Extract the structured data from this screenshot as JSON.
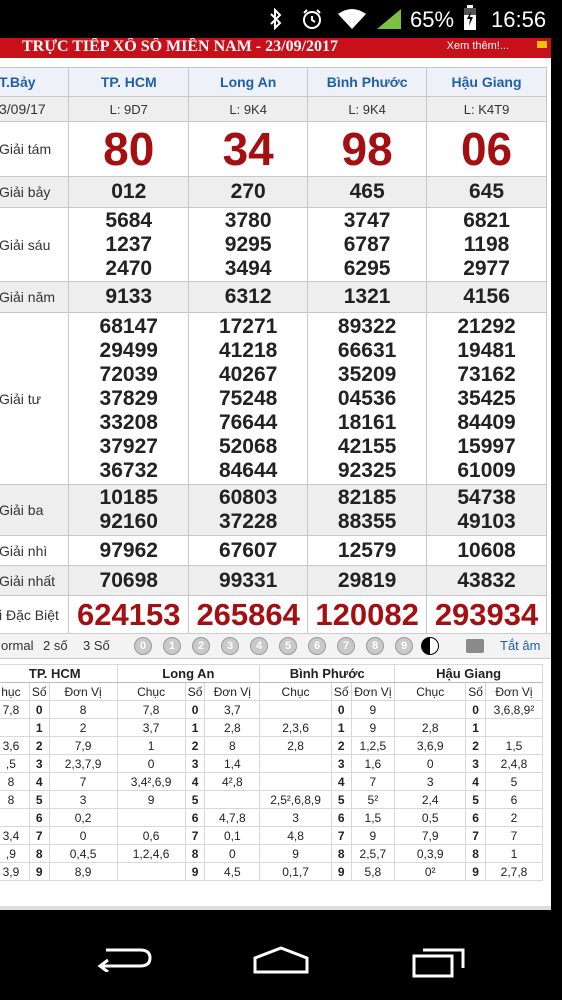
{
  "status_bar": {
    "battery": "65%",
    "time": "16:56"
  },
  "page": {
    "title": "TRỰC TIẾP XỔ SỐ MIỀN NAM - 23/09/2017",
    "more_link": "Xem thêm!..."
  },
  "results": {
    "day_label": "T.Bảy",
    "date": "3/09/17",
    "provinces": [
      "TP. HCM",
      "Long An",
      "Bình Phước",
      "Hậu Giang"
    ],
    "codes": [
      "L: 9D7",
      "L: 9K4",
      "L: 9K4",
      "L: K4T9"
    ],
    "prizes": [
      {
        "label": "Giải tám",
        "values": [
          [
            "80"
          ],
          [
            "34"
          ],
          [
            "98"
          ],
          [
            "06"
          ]
        ]
      },
      {
        "label": "Giải bảy",
        "values": [
          [
            "012"
          ],
          [
            "270"
          ],
          [
            "465"
          ],
          [
            "645"
          ]
        ]
      },
      {
        "label": "Giải sáu",
        "values": [
          [
            "5684",
            "1237",
            "2470"
          ],
          [
            "3780",
            "9295",
            "3494"
          ],
          [
            "3747",
            "6787",
            "6295"
          ],
          [
            "6821",
            "1198",
            "2977"
          ]
        ]
      },
      {
        "label": "Giải năm",
        "values": [
          [
            "9133"
          ],
          [
            "6312"
          ],
          [
            "1321"
          ],
          [
            "4156"
          ]
        ]
      },
      {
        "label": "Giải tư",
        "values": [
          [
            "68147",
            "29499",
            "72039",
            "37829",
            "33208",
            "37927",
            "36732"
          ],
          [
            "17271",
            "41218",
            "40267",
            "75248",
            "76644",
            "52068",
            "84644"
          ],
          [
            "89322",
            "66631",
            "35209",
            "04536",
            "18161",
            "42155",
            "92325"
          ],
          [
            "21292",
            "19481",
            "73162",
            "35425",
            "84409",
            "15997",
            "61009"
          ]
        ]
      },
      {
        "label": "Giải ba",
        "values": [
          [
            "10185",
            "92160"
          ],
          [
            "60803",
            "37228"
          ],
          [
            "82185",
            "88355"
          ],
          [
            "54738",
            "49103"
          ]
        ]
      },
      {
        "label": "Giải nhì",
        "values": [
          [
            "97962"
          ],
          [
            "67607"
          ],
          [
            "12579"
          ],
          [
            "10608"
          ]
        ]
      },
      {
        "label": "Giải nhất",
        "values": [
          [
            "70698"
          ],
          [
            "99331"
          ],
          [
            "29819"
          ],
          [
            "43832"
          ]
        ]
      },
      {
        "label": "i Đặc Biệt",
        "values": [
          [
            "624153"
          ],
          [
            "265864"
          ],
          [
            "120082"
          ],
          [
            "293934"
          ]
        ]
      }
    ]
  },
  "toolbar": {
    "mode_normal": "ormal",
    "mode_2": "2 số",
    "mode_3": "3 Số",
    "digits": [
      "0",
      "1",
      "2",
      "3",
      "4",
      "5",
      "6",
      "7",
      "8",
      "9"
    ],
    "mute_label": "Tắt âm"
  },
  "stats": {
    "col_chuc": "Chục",
    "col_so": "Số",
    "col_donvi": "Đơn Vị",
    "col_chuc_clipped": "hục",
    "provinces": [
      "TP. HCM",
      "Long An",
      "Bình Phước",
      "Hậu Giang"
    ],
    "rows": [
      [
        [
          "7,8",
          "0",
          "8"
        ],
        [
          "7,8",
          "0",
          "3,7"
        ],
        [
          "",
          "0",
          "9"
        ],
        [
          "",
          "0",
          "3,6,8,9²"
        ]
      ],
      [
        [
          "",
          "1",
          "2"
        ],
        [
          "3,7",
          "1",
          "2,8"
        ],
        [
          "2,3,6",
          "1",
          "9"
        ],
        [
          "2,8",
          "1",
          ""
        ]
      ],
      [
        [
          "3,6",
          "2",
          "7,9"
        ],
        [
          "1",
          "2",
          "8"
        ],
        [
          "2,8",
          "2",
          "1,2,5"
        ],
        [
          "3,6,9",
          "2",
          "1,5"
        ]
      ],
      [
        [
          ",5",
          "3",
          "2,3,7,9"
        ],
        [
          "0",
          "3",
          "1,4"
        ],
        [
          "",
          "3",
          "1,6"
        ],
        [
          "0",
          "3",
          "2,4,8"
        ]
      ],
      [
        [
          "8",
          "4",
          "7"
        ],
        [
          "3,4²,6,9",
          "4",
          "4²,8"
        ],
        [
          "",
          "4",
          "7"
        ],
        [
          "3",
          "4",
          "5"
        ]
      ],
      [
        [
          "8",
          "5",
          "3"
        ],
        [
          "9",
          "5",
          ""
        ],
        [
          "2,5²,6,8,9",
          "5",
          "5²"
        ],
        [
          "2,4",
          "5",
          "6"
        ]
      ],
      [
        [
          "",
          "6",
          "0,2"
        ],
        [
          "",
          "6",
          "4,7,8"
        ],
        [
          "3",
          "6",
          "1,5"
        ],
        [
          "0,5",
          "6",
          "2"
        ]
      ],
      [
        [
          "3,4",
          "7",
          "0"
        ],
        [
          "0,6",
          "7",
          "0,1"
        ],
        [
          "4,8",
          "7",
          "9"
        ],
        [
          "7,9",
          "7",
          "7"
        ]
      ],
      [
        [
          ",9",
          "8",
          "0,4,5"
        ],
        [
          "1,2,4,6",
          "8",
          "0"
        ],
        [
          "9",
          "8",
          "2,5,7"
        ],
        [
          "0,3,9",
          "8",
          "1"
        ]
      ],
      [
        [
          "3,9",
          "9",
          "8,9"
        ],
        [
          "",
          "9",
          "4,5"
        ],
        [
          "0,1,7",
          "9",
          "5,8"
        ],
        [
          "0²",
          "9",
          "2,7,8"
        ]
      ]
    ]
  },
  "colors": {
    "title_red": "#c8101a",
    "number_red": "#a40f12",
    "header_blue": "#1f5fa8",
    "status_green": "#7bc043"
  }
}
